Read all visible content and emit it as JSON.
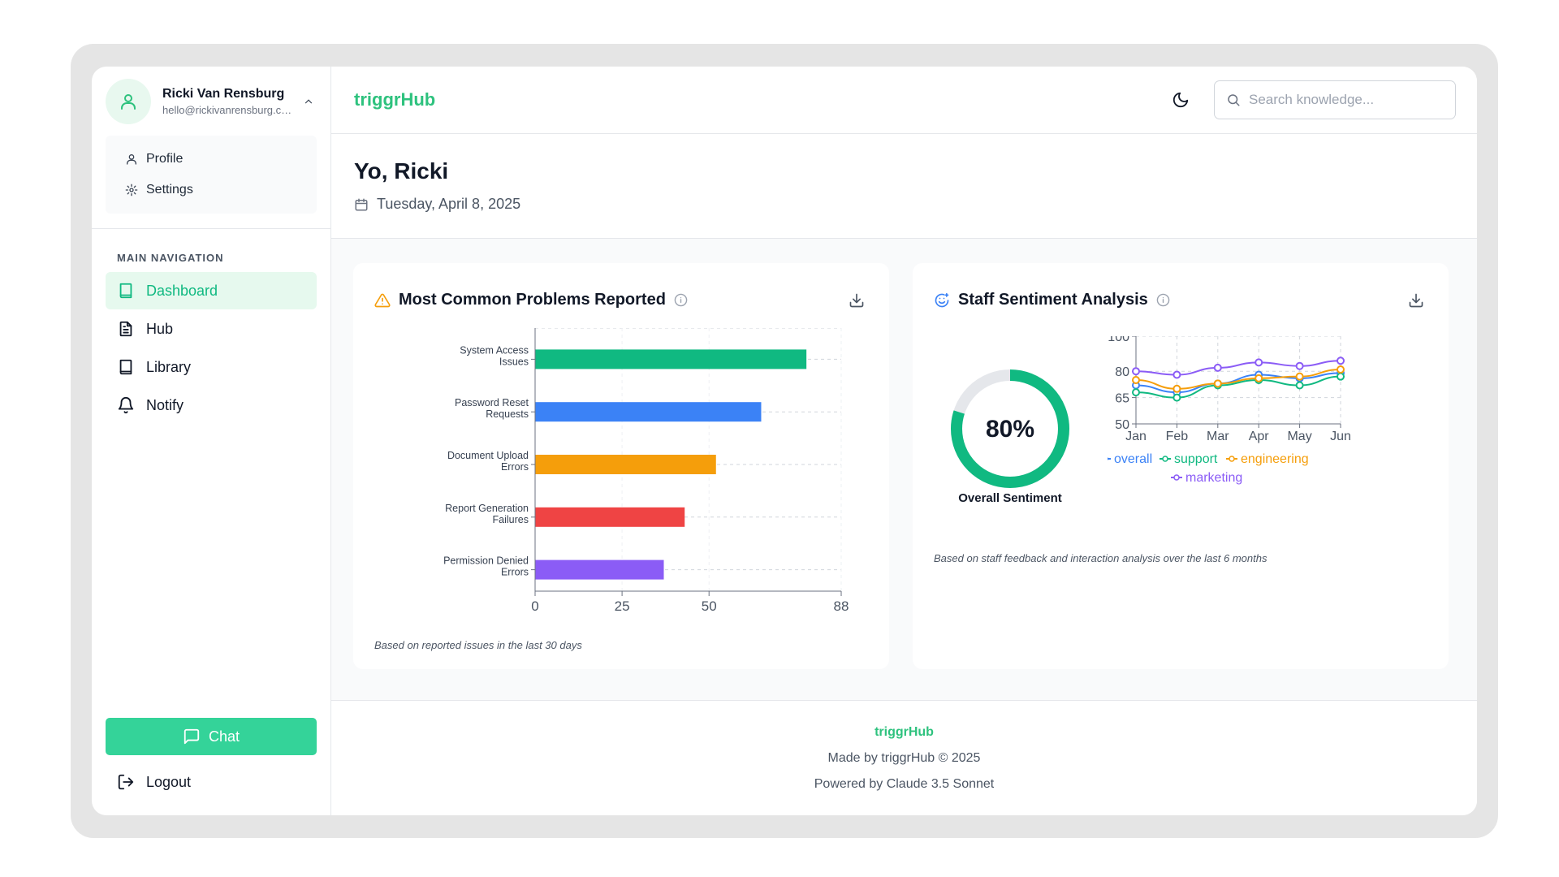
{
  "user": {
    "name": "Ricki Van Rensburg",
    "email": "hello@rickivanrensburg.com"
  },
  "user_menu": [
    {
      "label": "Profile",
      "icon": "user-icon"
    },
    {
      "label": "Settings",
      "icon": "gear-icon"
    }
  ],
  "nav": {
    "heading": "MAIN NAVIGATION",
    "items": [
      {
        "label": "Dashboard",
        "icon": "dashboard-book-icon",
        "active": true
      },
      {
        "label": "Hub",
        "icon": "document-icon",
        "active": false
      },
      {
        "label": "Library",
        "icon": "book-icon",
        "active": false
      },
      {
        "label": "Notify",
        "icon": "bell-icon",
        "active": false
      }
    ]
  },
  "chat_label": "Chat",
  "logout_label": "Logout",
  "brand": "triggrHub",
  "search": {
    "placeholder": "Search knowledge..."
  },
  "greeting": "Yo, Ricki",
  "date": "Tuesday, April 8, 2025",
  "colors": {
    "brand": "#2ec27e",
    "accent": "#34d399",
    "active_bg": "#e6f9ee"
  },
  "problems_card": {
    "title": "Most Common Problems Reported",
    "note": "Based on reported issues in the last 30 days"
  },
  "sentiment_card": {
    "title": "Staff Sentiment Analysis",
    "note": "Based on staff feedback and interaction analysis over the last 6 months",
    "gauge_value": "80%",
    "gauge_label": "Overall Sentiment"
  },
  "footer": {
    "brand": "triggrHub",
    "made_by": "Made by triggrHub © 2025",
    "powered_by": "Powered by Claude 3.5 Sonnet"
  },
  "chart_data": [
    {
      "type": "bar",
      "orientation": "horizontal",
      "title": "Most Common Problems Reported",
      "categories": [
        [
          "System Access",
          "Issues"
        ],
        [
          "Password Reset",
          "Requests"
        ],
        [
          "Document Upload",
          "Errors"
        ],
        [
          "Report Generation",
          "Failures"
        ],
        [
          "Permission Denied",
          "Errors"
        ]
      ],
      "values": [
        78,
        65,
        52,
        43,
        37
      ],
      "colors": [
        "#10b981",
        "#3b82f6",
        "#f59e0b",
        "#ef4444",
        "#8b5cf6"
      ],
      "xticks": [
        0,
        25,
        50,
        88
      ],
      "xlim": [
        0,
        88
      ],
      "grid": true
    },
    {
      "type": "pie",
      "subtype": "donut",
      "values": [
        80,
        20
      ],
      "colors": [
        "#10b981",
        "#e5e7eb"
      ],
      "label": "80%",
      "caption": "Overall Sentiment"
    },
    {
      "type": "line",
      "x": [
        "Jan",
        "Feb",
        "Mar",
        "Apr",
        "May",
        "Jun"
      ],
      "yticks": [
        50,
        65,
        80,
        100
      ],
      "ylim": [
        50,
        100
      ],
      "grid": true,
      "legend": "bottom",
      "series": [
        {
          "name": "overall",
          "color": "#3b82f6",
          "values": [
            72,
            68,
            73,
            78,
            76,
            79
          ]
        },
        {
          "name": "support",
          "color": "#10b981",
          "values": [
            68,
            65,
            72,
            75,
            72,
            77
          ]
        },
        {
          "name": "engineering",
          "color": "#f59e0b",
          "values": [
            75,
            70,
            73,
            76,
            77,
            81
          ]
        },
        {
          "name": "marketing",
          "color": "#8b5cf6",
          "values": [
            80,
            78,
            82,
            85,
            83,
            86
          ]
        }
      ]
    }
  ]
}
